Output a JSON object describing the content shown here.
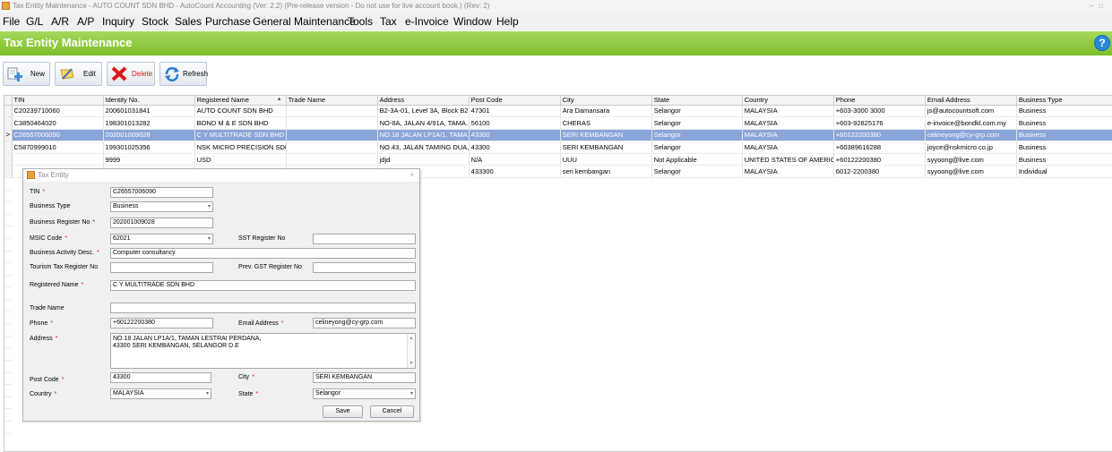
{
  "window": {
    "title": "Tax Entity Maintenance - AUTO COUNT SDN BHD - AutoCount Accounting (Ver: 2.2) (Pre-release version - Do not use for live account book.) (Rev: 2)"
  },
  "menu": [
    "File",
    "G/L",
    "A/R",
    "A/P",
    "Inquiry",
    "Stock",
    "Sales",
    "Purchase",
    "General Maintenance",
    "Tools",
    "Tax",
    "e-Invoice",
    "Window",
    "Help"
  ],
  "header": {
    "title": "Tax Entity Maintenance",
    "help": "?"
  },
  "toolbar": {
    "new": "New",
    "edit": "Edit",
    "delete": "Delete",
    "refresh": "Refresh"
  },
  "grid": {
    "columns": [
      "TIN",
      "Identity No.",
      "Registered Name",
      "Trade Name",
      "Address",
      "Post Code",
      "City",
      "State",
      "Country",
      "Phone",
      "Email Address",
      "Business Type"
    ],
    "rows": [
      [
        "C20239710060",
        "200601031841",
        "AUTO COUNT SDN BHD",
        "",
        "B2-3A-01, Level 3A, Block B2...",
        "47301",
        "Ara Damansara",
        "Selangor",
        "MALAYSIA",
        "+603-3000 3000",
        "js@autocountsoft.com",
        "Business"
      ],
      [
        "C3850464020",
        "198301013282",
        "BOND M & E SDN BHD",
        "",
        "NO-8A, JALAN 4/91A, TAMA...",
        "56100",
        "CHERAS",
        "Selangor",
        "MALAYSIA",
        "+603-92825176",
        "e-invoice@bondkl.com.my",
        "Business"
      ],
      [
        "C26557006090",
        "202001009028",
        "C Y MULTITRADE SDN BHD",
        "",
        "NO.18 JALAN LP1A/1, TAMA...",
        "43300",
        "SERI KEMBANGAN",
        "Selangor",
        "MALAYSIA",
        "+60122200380",
        "celineyong@cy-grp.com",
        "Business"
      ],
      [
        "C5870999010",
        "199301025356",
        "NSK MICRO PRECISION SDN...",
        "",
        "NO.43, JALAN TAMING DUA,...",
        "43300",
        "SERI KEMBANGAN",
        "Selangor",
        "MALAYSIA",
        "+60389616288",
        "joyce@nskmicro.co.jp",
        "Business"
      ],
      [
        "",
        "9999",
        "USD",
        "",
        "jdjd",
        "N/A",
        "UUU",
        "Not Applicable",
        "UNITED STATES OF AMERICA",
        "+60122200380",
        "syyoong@live.com",
        "Business"
      ],
      [
        "",
        "",
        "",
        "",
        "",
        "433300",
        "seri kembangan",
        "Selangor",
        "MALAYSIA",
        "6012-2200380",
        "syyoong@live.com",
        "Individual"
      ]
    ],
    "selected_marker": ">"
  },
  "dialog": {
    "title": "Tax Entity",
    "close": "×",
    "tin_label": "TIN",
    "tin": "C26557006090",
    "btype_label": "Business Type",
    "btype": "Business",
    "brn_label": "Business Register No",
    "brn": "202001009028",
    "msic_label": "MSIC Code",
    "msic": "62021",
    "sst_label": "SST Register No",
    "sst": "",
    "bad_label": "Business Activity Desc.",
    "bad": "Computer consultancy",
    "ttr_label": "Tourism Tax Register No",
    "ttr": "",
    "gst_label": "Prev. GST Register No",
    "gst": "",
    "regname_label": "Registered Name",
    "regname": "C Y MULTITRADE SDN BHD",
    "trade_label": "Trade Name",
    "trade": "",
    "phone_label": "Phone",
    "phone": "+60122200380",
    "email_label": "Email Address",
    "email": "celineyong@cy-grp.com",
    "address_label": "Address",
    "address": "NO.18 JALAN LP1A/1, TAMAN LESTRAI PERDANA,\n43300 SERI KEMBANGAN, SELANGOR D.E",
    "postcode_label": "Post Code",
    "postcode": "43300",
    "city_label": "City",
    "city": "SERI KEMBANGAN",
    "country_label": "Country",
    "country": "MALAYSIA",
    "state_label": "State",
    "state": "Selangor",
    "save": "Save",
    "cancel": "Cancel",
    "required_mark": "*"
  }
}
